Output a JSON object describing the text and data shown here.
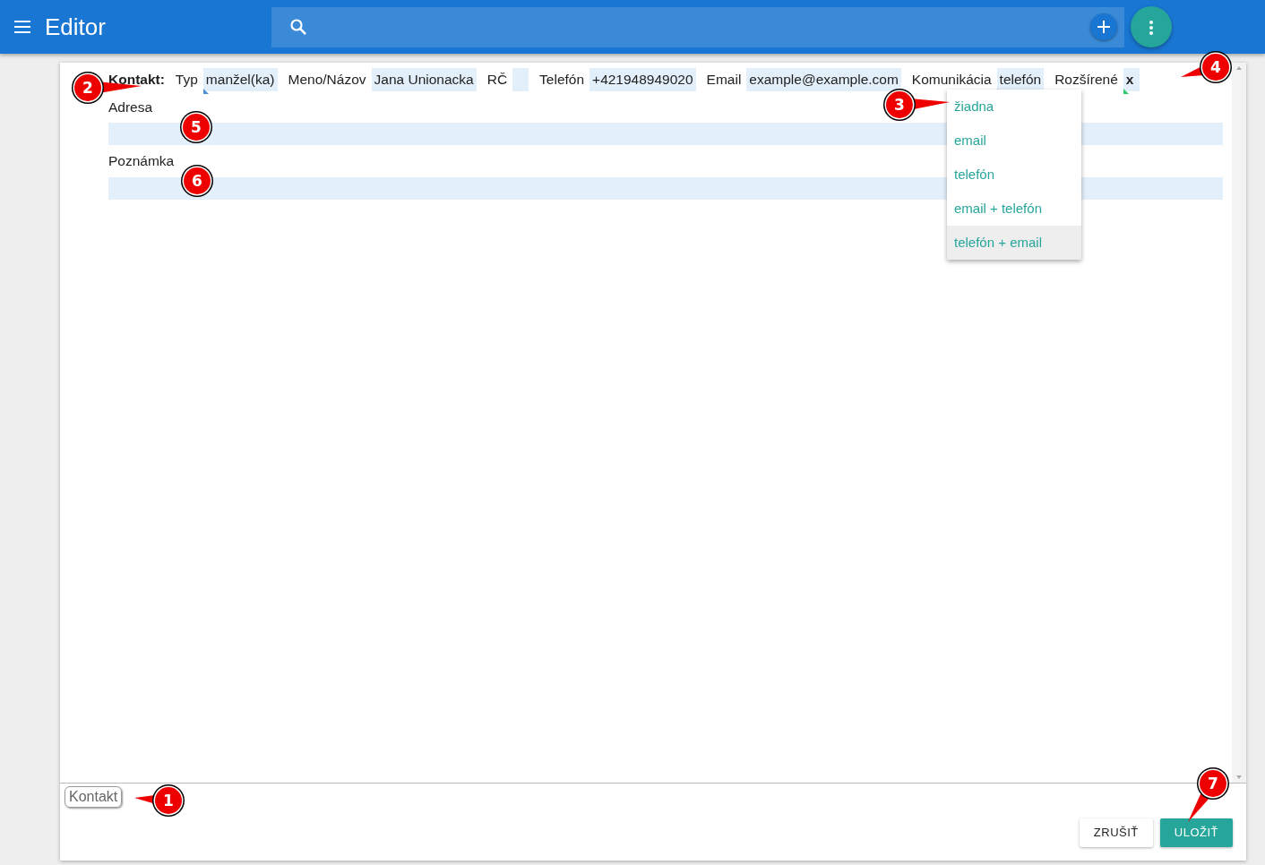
{
  "app_bar": {
    "title": "Editor"
  },
  "form": {
    "heading": "Kontakt:",
    "fields": [
      {
        "kind": "select",
        "label": "Typ",
        "value": "manžel(ka)"
      },
      {
        "kind": "text",
        "label": "Meno/Názov",
        "value": "Jana Unionacka"
      },
      {
        "kind": "text",
        "label": "RČ"
      },
      {
        "kind": "text",
        "label": "Telefón",
        "value": "+421948949020"
      },
      {
        "kind": "text",
        "label": "Email",
        "value": "example@example.com"
      },
      {
        "kind": "select",
        "label": "Komunikácia",
        "value": "telefón"
      },
      {
        "kind": "checkbox",
        "label": "Rozšírené",
        "value": "x"
      }
    ],
    "blocks": [
      {
        "label": "Adresa"
      },
      {
        "label": "Poznámka"
      }
    ]
  },
  "dropdown": {
    "open": true,
    "options": [
      {
        "label": "žiadna",
        "highlighted": false
      },
      {
        "label": "email",
        "highlighted": false
      },
      {
        "label": "telefón",
        "highlighted": false
      },
      {
        "label": "email + telefón",
        "highlighted": false
      },
      {
        "label": "telefón + email",
        "highlighted": true
      }
    ]
  },
  "footer": {
    "chip": "Kontakt",
    "buttons": [
      {
        "label": "ZRUŠIŤ",
        "kind": "flat"
      },
      {
        "label": "ULOŽIŤ",
        "kind": "primary"
      }
    ]
  },
  "callouts": [
    {
      "label": "1"
    },
    {
      "label": "2"
    },
    {
      "label": "3"
    },
    {
      "label": "4"
    },
    {
      "label": "5"
    },
    {
      "label": "6"
    },
    {
      "label": "7"
    }
  ]
}
